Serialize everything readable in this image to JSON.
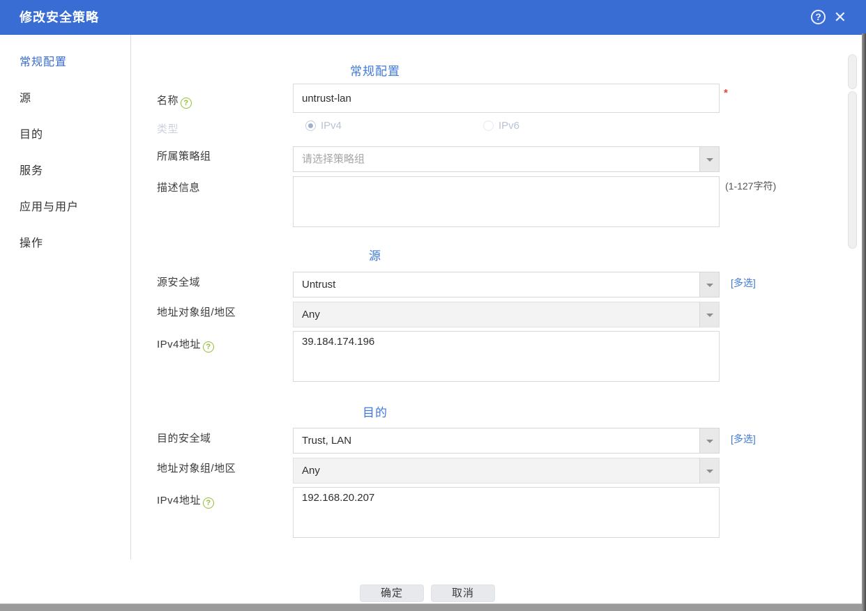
{
  "window": {
    "title": "修改安全策略"
  },
  "titlebar": {
    "help_icon": "?",
    "close_icon": "✕"
  },
  "sidebar": {
    "items": [
      {
        "label": "常规配置",
        "active": true
      },
      {
        "label": "源",
        "active": false
      },
      {
        "label": "目的",
        "active": false
      },
      {
        "label": "服务",
        "active": false
      },
      {
        "label": "应用与用户",
        "active": false
      },
      {
        "label": "操作",
        "active": false
      }
    ]
  },
  "general": {
    "section_title": "常规配置",
    "name_label": "名称",
    "name_help": "?",
    "name_value": "untrust-lan",
    "required_mark": "*",
    "type_label": "类型",
    "type_options": [
      "IPv4",
      "IPv6"
    ],
    "type_selected": "IPv4",
    "policy_group_label": "所属策略组",
    "policy_group_placeholder": "请选择策略组",
    "description_label": "描述信息",
    "description_value": "",
    "description_hint": "(1-127字符)"
  },
  "source": {
    "section_title": "源",
    "zone_label": "源安全域",
    "zone_value": "Untrust",
    "multi_select_label": "[多选]",
    "address_label": "地址对象组/地区",
    "address_value": "Any",
    "ipv4_label": "IPv4地址",
    "ipv4_help": "?",
    "ipv4_value": "39.184.174.196"
  },
  "destination": {
    "section_title": "目的",
    "zone_label": "目的安全域",
    "zone_value": "Trust, LAN",
    "multi_select_label": "[多选]",
    "address_label": "地址对象组/地区",
    "address_value": "Any",
    "ipv4_label": "IPv4地址",
    "ipv4_help": "?",
    "ipv4_value": "192.168.20.207"
  },
  "footer": {
    "ok_label": "确定",
    "cancel_label": "取消"
  },
  "colors": {
    "header_blue": "#3a6dd3",
    "accent_blue": "#3f7ad8",
    "help_green": "#8fc031",
    "required_red": "#e5413d"
  }
}
